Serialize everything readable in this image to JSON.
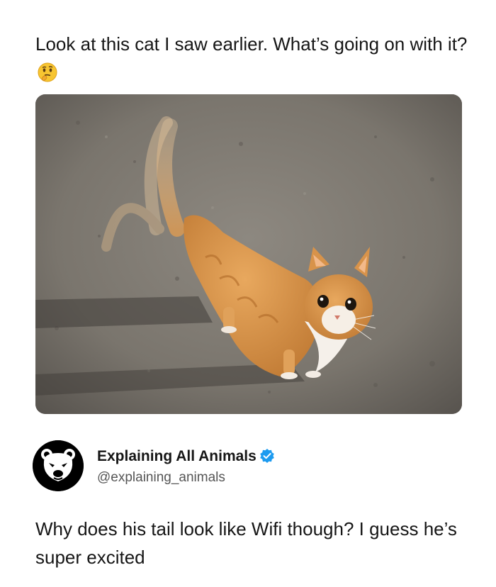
{
  "post": {
    "question_text": "Look at this cat I saw earlier. What’s going on with it?",
    "question_emoji": "thinking-face-icon"
  },
  "photo": {
    "subject": "orange tabby cat with blurred tail",
    "icon": "cat-photo"
  },
  "author": {
    "name": "Explaining All Animals",
    "handle": "@explaining_animals",
    "verified": true,
    "avatar_icon": "bear-face-icon",
    "verified_color": "#1d9bf0"
  },
  "reply": {
    "text": "Why does his tail look like Wifi though? I guess he’s super excited"
  }
}
